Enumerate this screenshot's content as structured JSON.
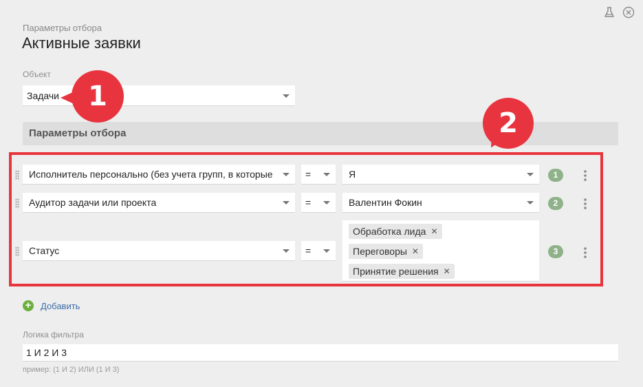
{
  "header": {
    "subtitle": "Параметры отбора",
    "title": "Активные заявки"
  },
  "object": {
    "label": "Объект",
    "value": "Задачи"
  },
  "section": {
    "title": "Параметры отбора"
  },
  "conditions": [
    {
      "field": "Исполнитель персонально (без учета групп, в которые",
      "operator": "=",
      "value": "Я",
      "number": "1"
    },
    {
      "field": "Аудитор задачи или проекта",
      "operator": "=",
      "value": "Валентин Фокин",
      "number": "2"
    },
    {
      "field": "Статус",
      "operator": "=",
      "values": [
        "Обработка лида",
        "Переговоры",
        "Принятие решения"
      ],
      "number": "3"
    }
  ],
  "add_link": "Добавить",
  "logic": {
    "label": "Логика фильтра",
    "value": "1 И 2 И 3",
    "hint": "пример: (1 И 2) ИЛИ (1 И 3)"
  },
  "callouts": [
    "1",
    "2"
  ],
  "colors": {
    "background": "#eeeeee",
    "highlight": "#e8343f",
    "badge": "#8fb28a",
    "add_icon": "#6bb03d",
    "link": "#3c6ea8"
  },
  "icons": [
    "flask-icon",
    "close-icon",
    "plus-icon",
    "drag-handle-icon",
    "kebab-menu-icon",
    "caret-down-icon"
  ]
}
